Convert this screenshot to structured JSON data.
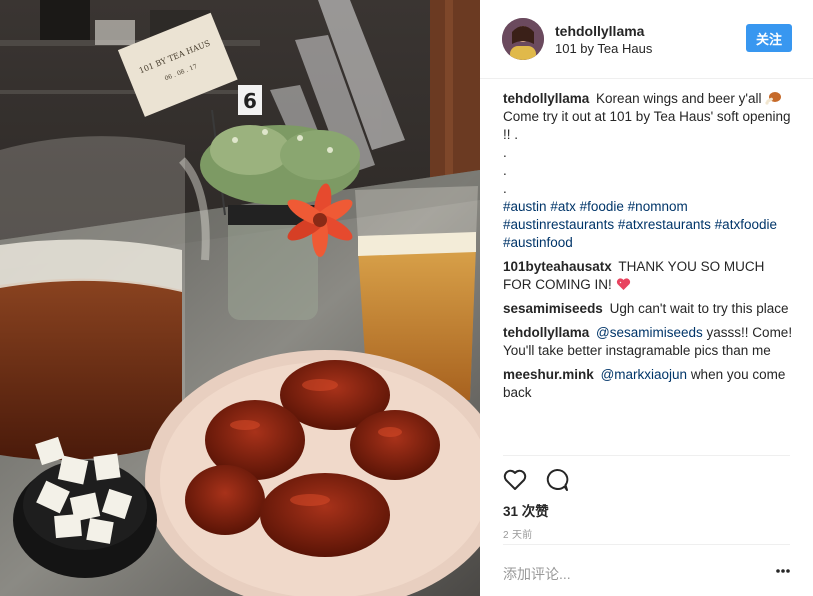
{
  "post": {
    "username": "tehdollyllama",
    "location": "101 by Tea Haus",
    "follow_label": "关注"
  },
  "photo": {
    "card_text": "101 BY TEA HAUS",
    "card_subtext": "06 . 08 . 17",
    "table_number": "6"
  },
  "caption": {
    "user": "tehdollyllama",
    "text": "Korean wings and beer y'all",
    "text2": "Come try it out at 101 by Tea Haus' soft opening !! .",
    "dots": [
      ".",
      ".",
      "."
    ],
    "hashtags_line1": [
      "#austin",
      "#atx",
      "#foodie",
      "#nomnom"
    ],
    "hashtags_line2": [
      "#austinrestaurants",
      "#atxrestaurants",
      "#atxfoodie"
    ],
    "hashtags_line3": [
      "#austinfood"
    ]
  },
  "comments": [
    {
      "user": "101byteahausatx",
      "text": "THANK YOU SO MUCH FOR COMING IN!"
    },
    {
      "user": "sesamimiseeds",
      "text": "Ugh can't wait to try this place"
    },
    {
      "user": "tehdollyllama",
      "mention": "@sesamimiseeds",
      "text": "yasss!! Come! You'll take better instagramable pics than me"
    },
    {
      "user": "meeshur.mink",
      "mention": "@markxiaojun",
      "text": "when you come back"
    }
  ],
  "stats": {
    "likes": "31 次赞",
    "time": "2 天前"
  },
  "composer": {
    "placeholder": "添加评论..."
  },
  "icons": {
    "like": "heart-outline-icon",
    "comment": "speech-bubble-icon",
    "more": "more-dots-icon"
  },
  "colors": {
    "follow_button": "#3897f0",
    "link": "#003569",
    "muted": "#999999"
  }
}
